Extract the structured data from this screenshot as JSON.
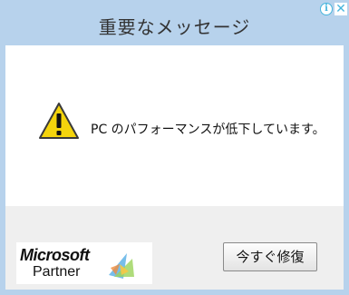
{
  "dialog": {
    "title": "重要なメッセージ",
    "message": "PC のパフォーマンスが低下しています。",
    "fix_button_label": "今すぐ修復"
  },
  "logo": {
    "brand": "Microsoft",
    "subtitle": "Partner"
  },
  "icons": {
    "warning": "warning-triangle-icon",
    "ad_info": "info-icon",
    "ad_close": "close-icon"
  },
  "colors": {
    "frame": "#b7d2ec",
    "warning_yellow": "#f4d40c",
    "ad_choices": "#47b5dd"
  }
}
